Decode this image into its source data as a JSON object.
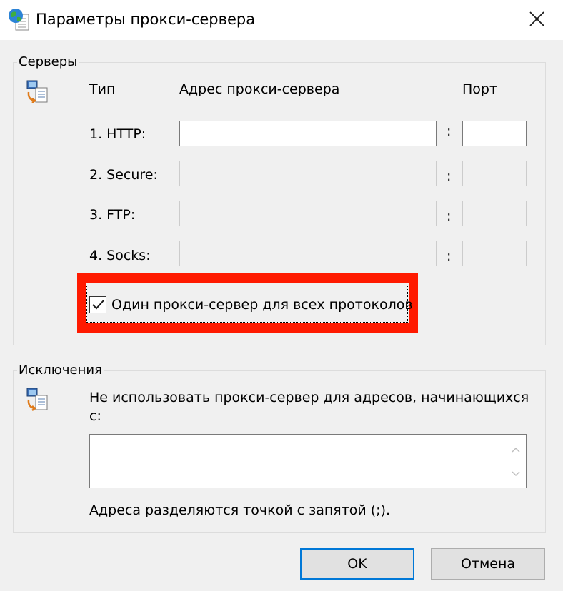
{
  "window": {
    "title": "Параметры прокси-сервера",
    "icon": "globe-document-icon"
  },
  "servers": {
    "group_label": "Серверы",
    "headers": {
      "type": "Тип",
      "address": "Адрес прокси-сервера",
      "port": "Порт"
    },
    "rows": [
      {
        "label": "1. HTTP:",
        "address": "",
        "port": "",
        "enabled": true
      },
      {
        "label": "2. Secure:",
        "address": "",
        "port": "",
        "enabled": false
      },
      {
        "label": "3. FTP:",
        "address": "",
        "port": "",
        "enabled": false
      },
      {
        "label": "4. Socks:",
        "address": "",
        "port": "",
        "enabled": false
      }
    ],
    "colon": ":",
    "same_proxy_label": "Один прокси-сервер для всех протоколов",
    "same_proxy_checked": true
  },
  "exceptions": {
    "group_label": "Исключения",
    "description_line1": "Не использовать прокси-сервер для адресов, начинающихся",
    "description_line2": "с:",
    "value": "",
    "hint": "Адреса разделяются точкой с запятой (;)."
  },
  "buttons": {
    "ok": "OK",
    "cancel": "Отмена"
  },
  "colors": {
    "highlight": "#ff1a00",
    "default_button_border": "#0078d7",
    "background": "#f0f0f0"
  }
}
